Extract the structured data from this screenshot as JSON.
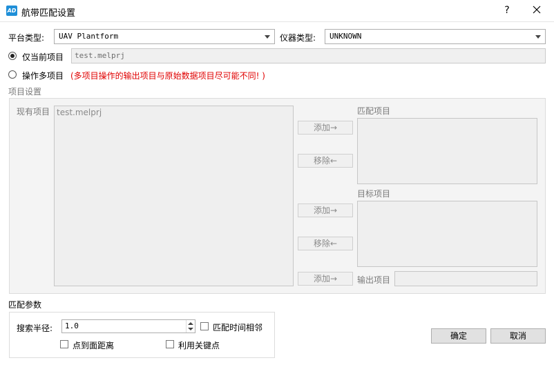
{
  "window": {
    "logo_text": "AD",
    "title": "航带匹配设置",
    "help": "?",
    "accent": "#1f8fd8"
  },
  "platform": {
    "label": "平台类型:",
    "value": "UAV Plantform"
  },
  "instrument": {
    "label": "仪器类型:",
    "value": "UNKNOWN"
  },
  "mode": {
    "current_label": "仅当前项目",
    "current_value": "test.melprj",
    "current_selected": true,
    "multi_label": "操作多项目",
    "multi_warning": "(多项目操作的输出项目与原始数据项目尽可能不同! )",
    "warning_color": "#e00000"
  },
  "project_settings": {
    "title": "项目设置",
    "existing_label": "现有项目",
    "existing_items": [
      "test.melprj"
    ],
    "match_label": "匹配项目",
    "target_label": "目标项目",
    "output_label": "输出项目",
    "output_value": "",
    "add_label": "添加→",
    "remove_label": "移除←"
  },
  "match_params": {
    "title": "匹配参数",
    "radius_label": "搜索半径:",
    "radius_value": "1.0",
    "time_adjacent_label": "匹配时间相邻",
    "point_to_plane_label": "点到面距离",
    "keypoints_label": "利用关键点"
  },
  "actions": {
    "ok_label": "确定",
    "cancel_label": "取消"
  }
}
